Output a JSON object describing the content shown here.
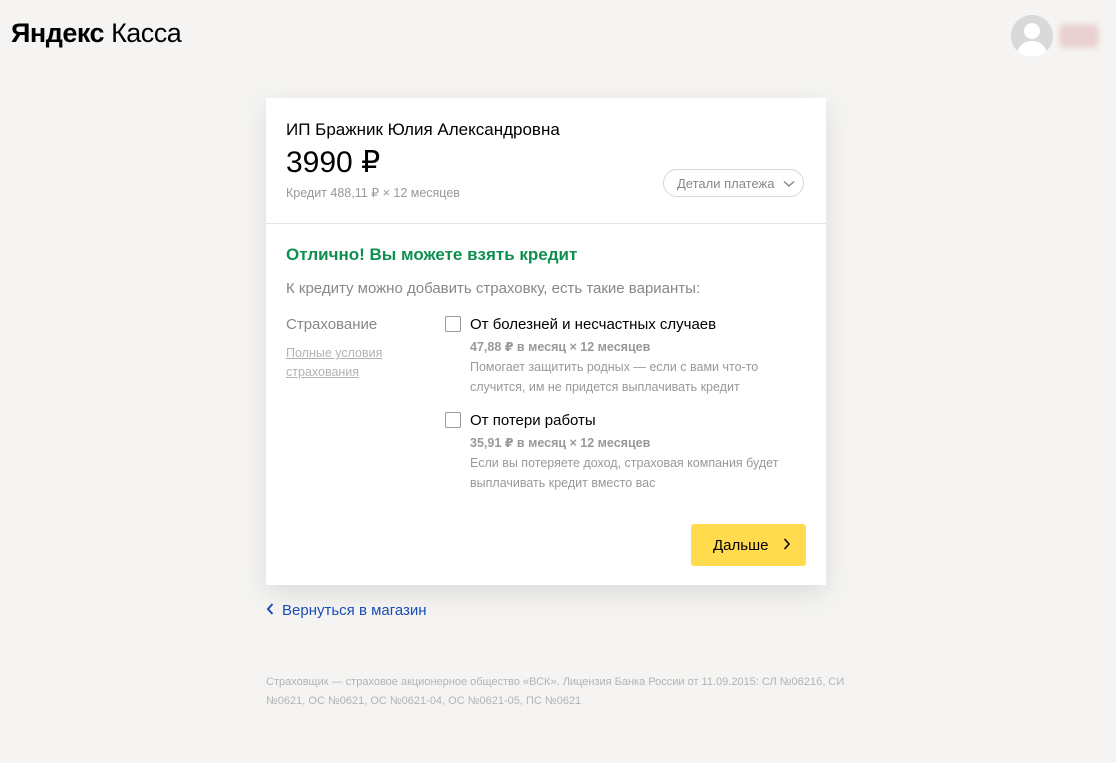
{
  "header": {
    "logo_brand": "Яндекс",
    "logo_product": "Касса"
  },
  "payment": {
    "merchant": "ИП Бражник Юлия Александровна",
    "amount": "3990 ₽",
    "credit_terms": "Кредит 488,11 ₽ × 12 месяцев",
    "details_button": "Детали платежа"
  },
  "credit": {
    "headline": "Отлично! Вы можете взять кредит",
    "subhead": "К кредиту можно добавить страховку, есть такие варианты:",
    "insurance_label": "Страхование",
    "insurance_terms_link": "Полные условия страхования",
    "options": [
      {
        "title": "От болезней и несчастных случаев",
        "price": "47,88 ₽ в месяц × 12 месяцев",
        "description": "Помогает защитить родных — если с вами что-то случится, им не придется выплачивать кредит",
        "checked": false
      },
      {
        "title": "От потери работы",
        "price": "35,91 ₽ в месяц × 12 месяцев",
        "description": "Если вы потеряете доход, страховая компания будет выплачивать кредит вместо вас",
        "checked": false
      }
    ],
    "next_button": "Дальше"
  },
  "back_link": "Вернуться в магазин",
  "footer": "Страховщик — страховое акционерное общество «ВСК». Лицензия Банка России от 11.09.2015: СЛ №0621б, СИ №0621, ОС №0621, ОС №0621-04, ОС №0621-05, ПС №0621",
  "colors": {
    "background": "#f5f4f2",
    "success_green": "#0f8f4f",
    "button_yellow": "#ffdb4d",
    "link_blue": "#1a4db5"
  },
  "icons": {
    "details_chevron": "chevron-down-icon",
    "next_arrow": "chevron-right-icon",
    "back_chevron": "chevron-left-icon",
    "avatar": "user-avatar-icon"
  }
}
